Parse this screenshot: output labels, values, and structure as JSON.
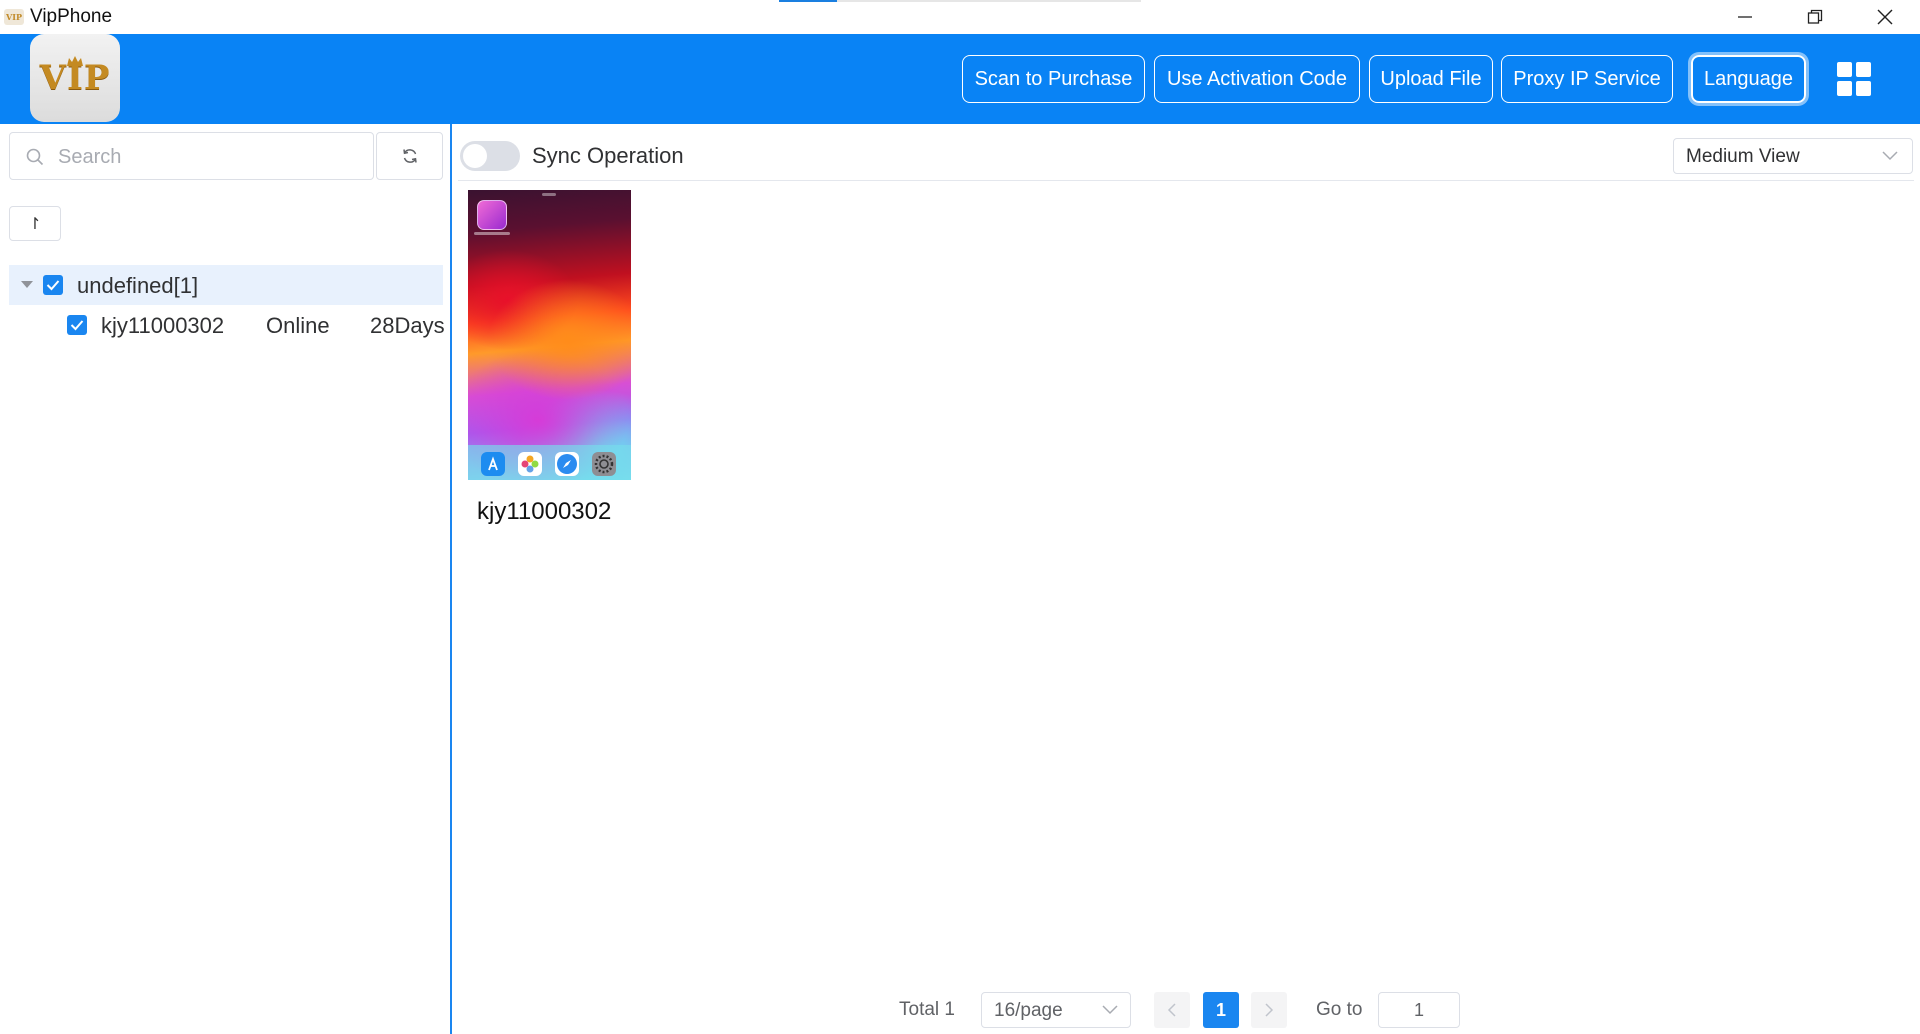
{
  "window": {
    "title": "VipPhone",
    "loading_progress": 0.16,
    "controls": {
      "minimize_icon": "minimize-icon",
      "restore_icon": "restore-icon",
      "close_icon": "close-icon"
    }
  },
  "header": {
    "logo_text": "VIP",
    "buttons": {
      "scan_to_purchase": "Scan to Purchase",
      "use_activation_code": "Use Activation Code",
      "upload_file": "Upload File",
      "proxy_ip_service": "Proxy IP Service",
      "language": "Language"
    },
    "layout_icon": "grid-icon",
    "accent_color": "#0983f5"
  },
  "sidebar": {
    "search": {
      "placeholder": "Search",
      "value": ""
    },
    "refresh_icon": "refresh-icon",
    "sort_label": "↾",
    "tree": {
      "group": {
        "label": "undefined[1]",
        "checked": true,
        "expanded": true
      },
      "devices": [
        {
          "name": "kjy11000302",
          "status": "Online",
          "remaining": "28Days",
          "checked": true
        }
      ]
    }
  },
  "main": {
    "sync_operation": {
      "label": "Sync Operation",
      "enabled": false
    },
    "view_select": {
      "value": "Medium View"
    },
    "phones": [
      {
        "name": "kjy11000302"
      }
    ]
  },
  "pagination": {
    "total_label": "Total 1",
    "page_size": "16/page",
    "current_page": "1",
    "goto_label": "Go to",
    "goto_value": "1"
  }
}
